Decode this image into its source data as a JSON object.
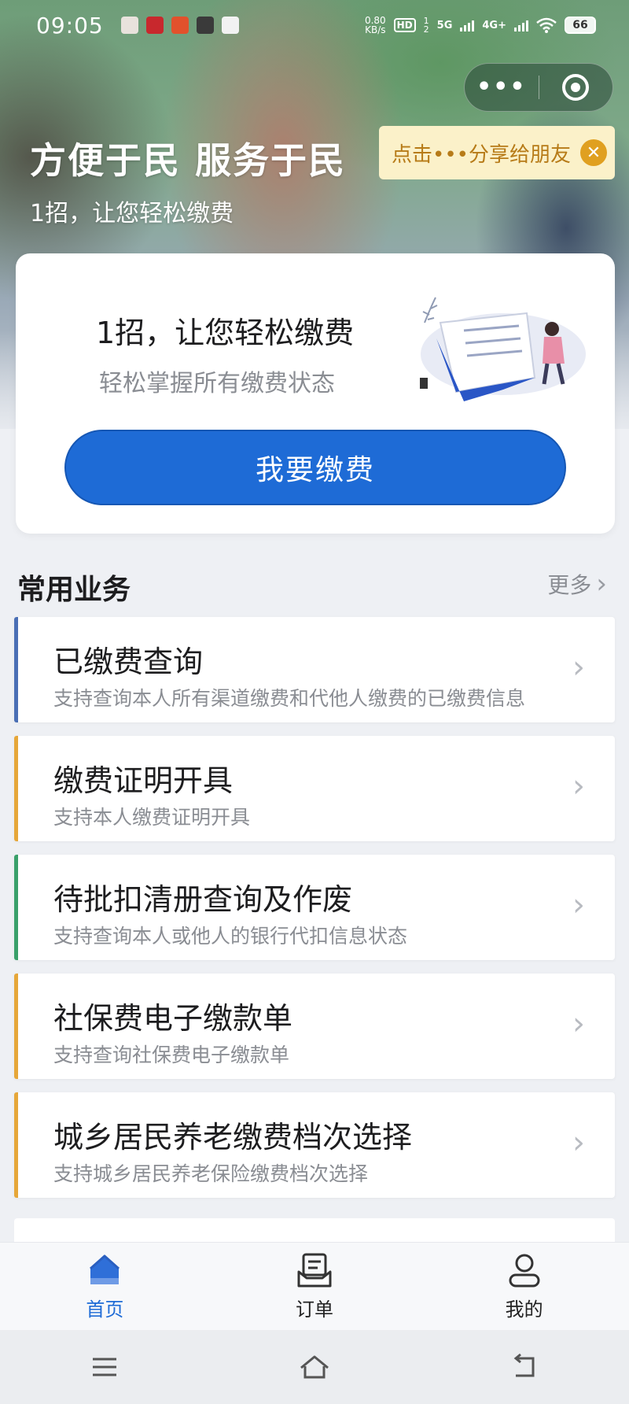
{
  "status_bar": {
    "time": "09:05",
    "net_speed_value": "0.80",
    "net_speed_unit": "KB/s",
    "hd": "HD",
    "sim1": "1",
    "sim2": "2",
    "network_5g": "5G",
    "network_4g": "4G+",
    "battery": "66"
  },
  "capsule": {
    "more_icon": "more-dots-icon",
    "close_icon": "target-icon"
  },
  "share_tip": {
    "text": "点击•••分享给朋友",
    "close_symbol": "✕"
  },
  "hero": {
    "title": "方便于民 服务于民",
    "subtitle": "1招，让您轻松缴费"
  },
  "pay_card": {
    "title": "1招，让您轻松缴费",
    "description": "轻松掌握所有缴费状态",
    "button_label": "我要缴费"
  },
  "services_section": {
    "title": "常用业务",
    "more_label": "更多",
    "items": [
      {
        "title": "已缴费查询",
        "description": "支持查询本人所有渠道缴费和代他人缴费的已缴费信息",
        "accent": "#4a6fb5"
      },
      {
        "title": "缴费证明开具",
        "description": "支持本人缴费证明开具",
        "accent": "#e6a73a"
      },
      {
        "title": "待批扣清册查询及作废",
        "description": "支持查询本人或他人的银行代扣信息状态",
        "accent": "#3aa06a"
      },
      {
        "title": "社保费电子缴款单",
        "description": "支持查询社保费电子缴款单",
        "accent": "#e6a73a"
      },
      {
        "title": "城乡居民养老缴费档次选择",
        "description": "支持城乡居民养老保险缴费档次选择",
        "accent": "#e6a73a"
      }
    ]
  },
  "tab_bar": {
    "tabs": [
      {
        "label": "首页",
        "icon": "home-icon",
        "active": true
      },
      {
        "label": "订单",
        "icon": "order-icon",
        "active": false
      },
      {
        "label": "我的",
        "icon": "profile-icon",
        "active": false
      }
    ]
  },
  "system_nav": {
    "buttons": [
      "menu-icon",
      "home-icon",
      "back-icon"
    ]
  },
  "colors": {
    "primary": "#1e6bd6",
    "tip_bg": "#fbf1c9",
    "tip_text": "#b77b18"
  }
}
